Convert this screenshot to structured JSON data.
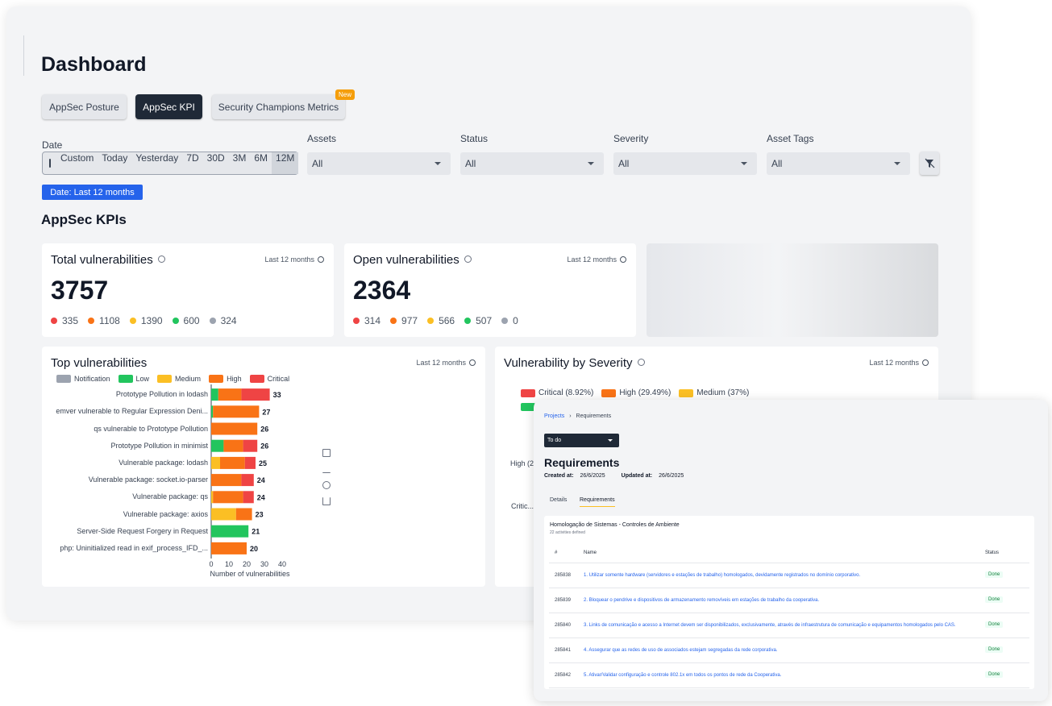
{
  "dashboard": {
    "title": "Dashboard",
    "tabs": [
      {
        "label": "AppSec Posture"
      },
      {
        "label": "AppSec KPI"
      },
      {
        "label": "Security Champions Metrics"
      }
    ],
    "new_badge": "New",
    "filters": {
      "date_label": "Date",
      "date_options": [
        "Custom",
        "Today",
        "Yesterday",
        "7D",
        "30D",
        "3M",
        "6M",
        "12M"
      ],
      "assets_label": "Assets",
      "assets_value": "All",
      "status_label": "Status",
      "status_value": "All",
      "severity_label": "Severity",
      "severity_value": "All",
      "tags_label": "Asset Tags",
      "tags_value": "All"
    },
    "date_chip": "Date: Last 12 months",
    "section_title": "AppSec KPIs",
    "colors": {
      "critical": "#ef4444",
      "high": "#f97316",
      "medium": "#fbbf24",
      "low": "#22c55e",
      "notification": "#9ca3af"
    },
    "total": {
      "title": "Total vulnerabilities",
      "period": "Last 12 months",
      "value": "3757",
      "counts": [
        "335",
        "1108",
        "1390",
        "600",
        "324"
      ]
    },
    "open": {
      "title": "Open vulnerabilities",
      "period": "Last 12 months",
      "value": "2364",
      "counts": [
        "314",
        "977",
        "566",
        "507",
        "0"
      ]
    },
    "top": {
      "title": "Top vulnerabilities",
      "period": "Last 12 months",
      "legend": [
        "Notification",
        "Low",
        "Medium",
        "High",
        "Critical"
      ]
    },
    "severity_card": {
      "title": "Vulnerability by Severity",
      "period": "Last 12 months",
      "legend": [
        "Critical (8.92%)",
        "High (29.49%)",
        "Medium (37%)"
      ],
      "label_high": "High (2",
      "label_critical": "Critic..."
    }
  },
  "chart_data": {
    "type": "bar",
    "orientation": "horizontal",
    "stacked": true,
    "xlabel": "Number of vulnerabilities",
    "xlim": [
      0,
      40
    ],
    "xticks": [
      "0",
      "10",
      "20",
      "30",
      "40"
    ],
    "categories": [
      "Prototype Pollution in lodash",
      "emver vulnerable to Regular Expression Deni...",
      "qs vulnerable to Prototype Pollution",
      "Prototype Pollution in minimist",
      "Vulnerable package: lodash",
      "Vulnerable package: socket.io-parser",
      "Vulnerable package: qs",
      "Vulnerable package: axios",
      "Server-Side Request Forgery in Request",
      "php: Uninitialized read in exif_process_IFD_..."
    ],
    "series": [
      {
        "name": "Low",
        "values": [
          4,
          1,
          0,
          7,
          0,
          0,
          0,
          0,
          21,
          0
        ]
      },
      {
        "name": "Medium",
        "values": [
          0,
          0,
          0,
          0,
          5,
          0,
          1,
          14,
          0,
          0
        ]
      },
      {
        "name": "High",
        "values": [
          13,
          26,
          26,
          11,
          14,
          17,
          17,
          9,
          0,
          20
        ]
      },
      {
        "name": "Critical",
        "values": [
          16,
          0,
          0,
          8,
          6,
          7,
          6,
          0,
          0,
          0
        ]
      }
    ],
    "totals": [
      "33",
      "27",
      "26",
      "26",
      "25",
      "24",
      "24",
      "23",
      "21",
      "20"
    ]
  },
  "requirements": {
    "breadcrumb": [
      "Projects",
      "Requirements"
    ],
    "status_select": "To do",
    "title": "Requirements",
    "created_label": "Created at:",
    "created_value": "26/6/2025",
    "updated_label": "Updated at:",
    "updated_value": "26/6/2025",
    "tabs": [
      "Details",
      "Requirements"
    ],
    "group_title": "Homologação de Sistemas - Controles de Ambiente",
    "group_sub": "22 activities defined",
    "columns": [
      "#",
      "Name",
      "Status"
    ],
    "rows": [
      {
        "id": "285838",
        "name": "1. Utilizar somente hardware (servidores e estações de trabalho) homologados, devidamente registrados no domínio corporativo.",
        "status": "Done"
      },
      {
        "id": "285839",
        "name": "2. Bloquear o pendrive e dispositivos de armazenamento removíveis em estações de trabalho da cooperativa.",
        "status": "Done"
      },
      {
        "id": "285840",
        "name": "3. Links de comunicação e acesso a Internet devem ser disponibilizados, exclusivamente, através de infraestrutura de comunicação e equipamentos homologados pelo CAS.",
        "status": "Done"
      },
      {
        "id": "285841",
        "name": "4. Assegurar que as redes de uso de associados estejam segregadas da rede corporativa.",
        "status": "Done"
      },
      {
        "id": "285842",
        "name": "5. Ativar/Validar configuração e controle 802.1x em todos os pontos de rede da Cooperativa.",
        "status": "Done"
      }
    ]
  }
}
